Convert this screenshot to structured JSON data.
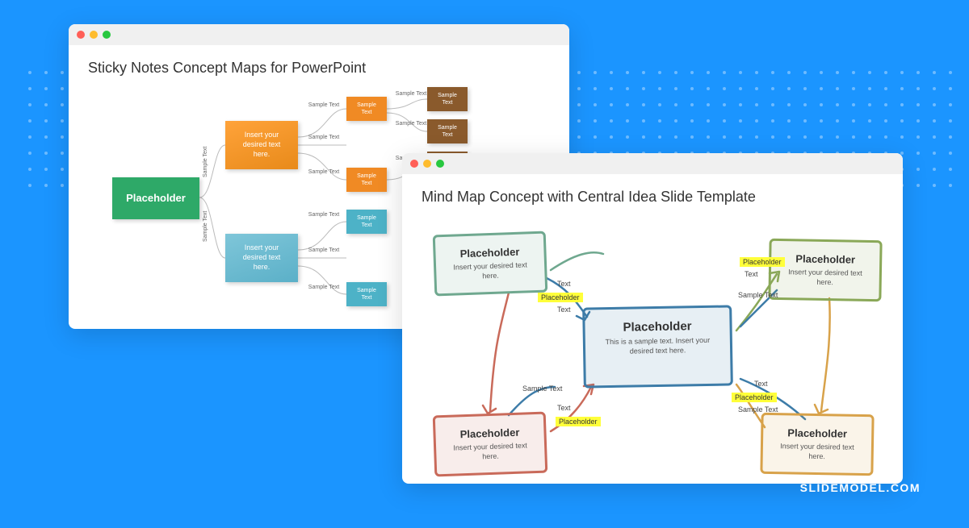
{
  "brand": "SLIDEMODEL.COM",
  "window1": {
    "title": "Sticky Notes Concept Maps for PowerPoint",
    "root": "Placeholder",
    "mid_text": "Insert your desired text here.",
    "sample_text": "Sample Text",
    "sample_text_nl": "Sample\nText"
  },
  "window2": {
    "title": "Mind Map Concept with Central Idea Slide Template",
    "center_title": "Placeholder",
    "center_sub": "This is a sample text. Insert your desired text here.",
    "box_title": "Placeholder",
    "box_sub": "Insert your desired text here.",
    "hl": "Placeholder",
    "text": "Text",
    "sample_text": "Sample Text"
  }
}
